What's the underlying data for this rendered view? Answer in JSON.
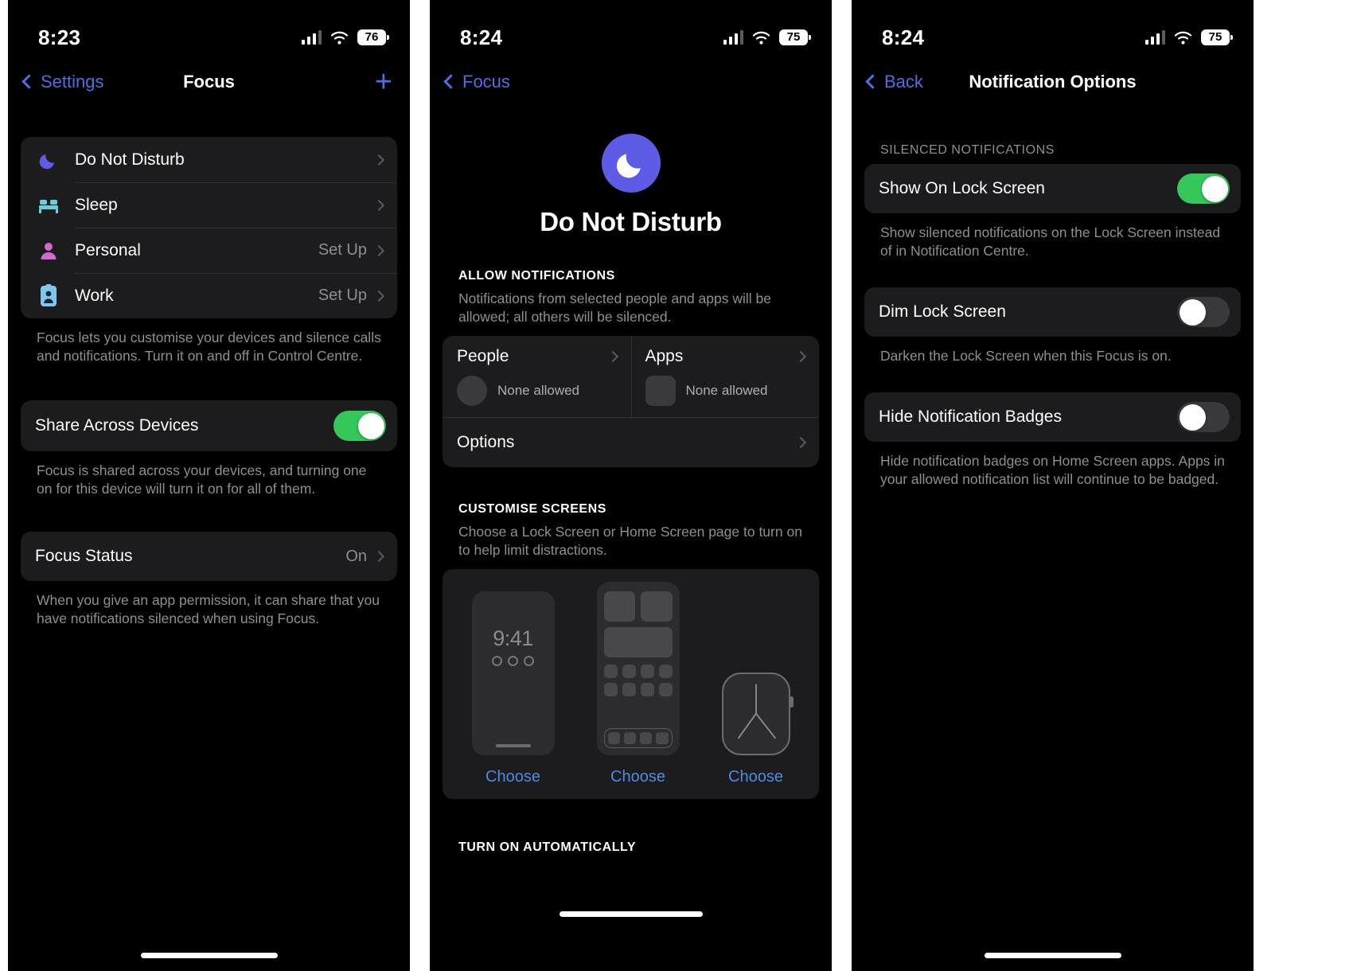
{
  "panel1": {
    "status": {
      "time": "8:23",
      "battery": "76",
      "signal_icon": "cellular-bars-icon",
      "wifi_icon": "wifi-icon",
      "battery_icon": "battery-icon"
    },
    "nav": {
      "back_label": "Settings",
      "title": "Focus",
      "add_label": "+"
    },
    "focus_list": [
      {
        "label": "Do Not Disturb",
        "value": "",
        "icon": "moon-icon"
      },
      {
        "label": "Sleep",
        "value": "",
        "icon": "bed-icon"
      },
      {
        "label": "Personal",
        "value": "Set Up",
        "icon": "person-icon"
      },
      {
        "label": "Work",
        "value": "Set Up",
        "icon": "id-badge-icon"
      }
    ],
    "focus_footnote": "Focus lets you customise your devices and silence calls and notifications. Turn it on and off in Control Centre.",
    "share": {
      "label": "Share Across Devices",
      "enabled": true
    },
    "share_footnote": "Focus is shared across your devices, and turning one on for this device will turn it on for all of them.",
    "status_row": {
      "label": "Focus Status",
      "value": "On"
    },
    "status_footnote": "When you give an app permission, it can share that you have notifications silenced when using Focus."
  },
  "panel2": {
    "status": {
      "time": "8:24",
      "battery": "75"
    },
    "nav": {
      "back_label": "Focus",
      "title": ""
    },
    "hero": {
      "title": "Do Not Disturb",
      "icon": "moon-icon",
      "accent": "#5e5ce6"
    },
    "allow": {
      "heading": "ALLOW NOTIFICATIONS",
      "subtext": "Notifications from selected people and apps will be allowed; all others will be silenced.",
      "people": {
        "title": "People",
        "value": "None allowed"
      },
      "apps": {
        "title": "Apps",
        "value": "None allowed"
      },
      "options": {
        "title": "Options"
      }
    },
    "customise": {
      "heading": "CUSTOMISE SCREENS",
      "subtext": "Choose a Lock Screen or Home Screen page to turn on to help limit distractions.",
      "lockscreen_time": "9:41",
      "choose_lock": "Choose",
      "choose_home": "Choose",
      "choose_watch": "Choose"
    },
    "turn_on": {
      "heading": "TURN ON AUTOMATICALLY"
    }
  },
  "panel3": {
    "status": {
      "time": "8:24",
      "battery": "75"
    },
    "nav": {
      "back_label": "Back",
      "title": "Notification Options"
    },
    "section_heading": "SILENCED NOTIFICATIONS",
    "rows": [
      {
        "label": "Show On Lock Screen",
        "enabled": true,
        "footnote": "Show silenced notifications on the Lock Screen instead of in Notification Centre."
      },
      {
        "label": "Dim Lock Screen",
        "enabled": false,
        "footnote": "Darken the Lock Screen when this Focus is on."
      },
      {
        "label": "Hide Notification Badges",
        "enabled": false,
        "footnote": "Hide notification badges on Home Screen apps. Apps in your allowed notification list will continue to be badged."
      }
    ]
  },
  "colors": {
    "accent_blue": "#4e6fe0",
    "link_blue": "#4e8ae0",
    "toggle_on": "#34c759",
    "card": "#1c1c1e",
    "background": "#000000",
    "purple": "#5e5ce6",
    "teal": "#64d2d8",
    "pink": "#d269d2"
  }
}
